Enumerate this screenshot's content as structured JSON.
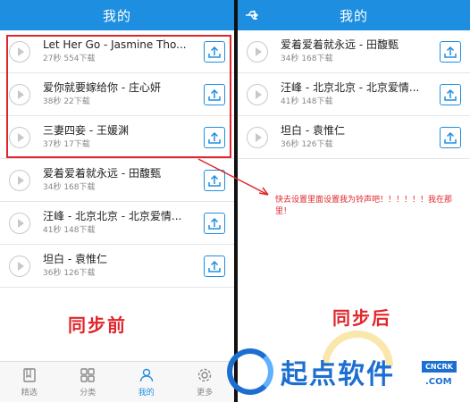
{
  "left_panel": {
    "header_title": "我的",
    "songs": [
      {
        "title": "Let Her Go - Jasmine Tho...",
        "meta": "27秒 554下载"
      },
      {
        "title": "爱你就要嫁给你 - 庄心妍",
        "meta": "38秒 22下载"
      },
      {
        "title": "三妻四妾 - 王媛渊",
        "meta": "37秒 17下载"
      },
      {
        "title": "爱着爱着就永远 - 田馥甄",
        "meta": "34秒 168下载"
      },
      {
        "title": "汪峰 - 北京北京 - 北京爱情...",
        "meta": "41秒 148下载"
      },
      {
        "title": "坦白 - 袁惟仁",
        "meta": "36秒 126下载"
      }
    ],
    "annotation": "同步前",
    "tabs": [
      {
        "label": "精选",
        "icon": "book-icon"
      },
      {
        "label": "分类",
        "icon": "grid-icon"
      },
      {
        "label": "我的",
        "icon": "person-icon"
      },
      {
        "label": "更多",
        "icon": "gear-icon"
      }
    ]
  },
  "right_panel": {
    "header_title": "我的",
    "songs": [
      {
        "title": "爱着爱着就永远 - 田馥甄",
        "meta": "34秒 168下载"
      },
      {
        "title": "汪峰 - 北京北京 - 北京爱情...",
        "meta": "41秒 148下载"
      },
      {
        "title": "坦白 - 袁惟仁",
        "meta": "36秒 126下载"
      }
    ],
    "tip": "快去设置里面设置我为铃声吧！！！！！！我在那里！",
    "annotation": "同步后"
  },
  "watermark": {
    "brand": "起点软件",
    "badge": "CNCRK",
    "domain": ".COM"
  },
  "colors": {
    "header_blue": "#1e8fe0",
    "annotation_red": "#e0262b",
    "watermark_blue": "#1c6fd1"
  }
}
